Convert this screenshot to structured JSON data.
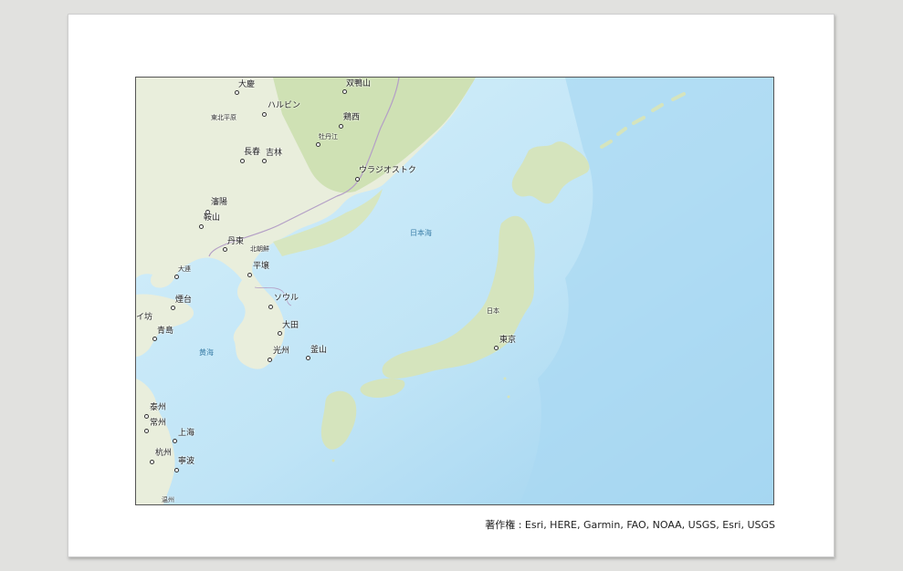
{
  "map": {
    "colors": {
      "sea_deep": "#9fd2f0",
      "sea_shallow": "#cbeaf9",
      "land": "#e9eedc",
      "forest": "#cfe1b4",
      "border": "#b49fc6"
    },
    "labels": {
      "daqing": "大慶",
      "shuangyashan": "双鴨山",
      "harbin": "ハルビン",
      "northeast_plain": "東北平原",
      "jixi": "鶏西",
      "mudanjiang": "牡丹江",
      "changchun": "長春",
      "jilin": "吉林",
      "vladivostok": "ウラジオストク",
      "shenyang": "瀋陽",
      "anshan": "鞍山",
      "dandong": "丹東",
      "north_korea": "北朝鮮",
      "dalian": "大連",
      "pyongyang": "平壌",
      "yantai": "煙台",
      "weifang": "イ坊",
      "qingdao": "青島",
      "seoul": "ソウル",
      "daejeon": "大田",
      "gwangju": "光州",
      "busan": "釜山",
      "yellow_sea": "黄海",
      "sea_of_japan": "日本海",
      "japan": "日本",
      "tokyo": "東京",
      "taizhou": "泰州",
      "changzhou": "常州",
      "shanghai": "上海",
      "hangzhou": "杭州",
      "ningbo": "寧波",
      "wenzhou": "温州"
    }
  },
  "attribution": "著作権 : Esri, HERE, Garmin, FAO, NOAA, USGS, Esri, USGS"
}
